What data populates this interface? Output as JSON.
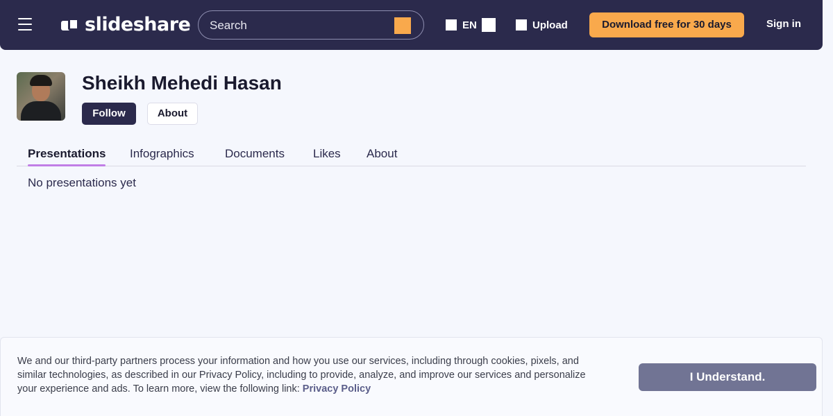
{
  "header": {
    "logo_text": "slideshare",
    "search_placeholder": "Search",
    "language": "EN",
    "upload_label": "Upload",
    "download_label": "Download free for 30 days",
    "signin_label": "Sign in",
    "accent_color": "#f9a94c",
    "bar_color": "#2b2a4c"
  },
  "profile": {
    "name": "Sheikh Mehedi Hasan",
    "follow_label": "Follow",
    "about_label": "About"
  },
  "tabs": [
    {
      "label": "Presentations",
      "active": true
    },
    {
      "label": "Infographics",
      "active": false
    },
    {
      "label": "Documents",
      "active": false
    },
    {
      "label": "Likes",
      "active": false
    },
    {
      "label": "About",
      "active": false
    }
  ],
  "content": {
    "empty_message": "No presentations yet"
  },
  "cookie_banner": {
    "text": "We and our third-party partners process your information and how you use our services, including through cookies, pixels, and similar technologies, as described in our Privacy Policy, including to provide, analyze, and improve our services and personalize your experience and ads. To learn more, view the following link: ",
    "link_label": "Privacy Policy",
    "button_label": "I Understand."
  }
}
